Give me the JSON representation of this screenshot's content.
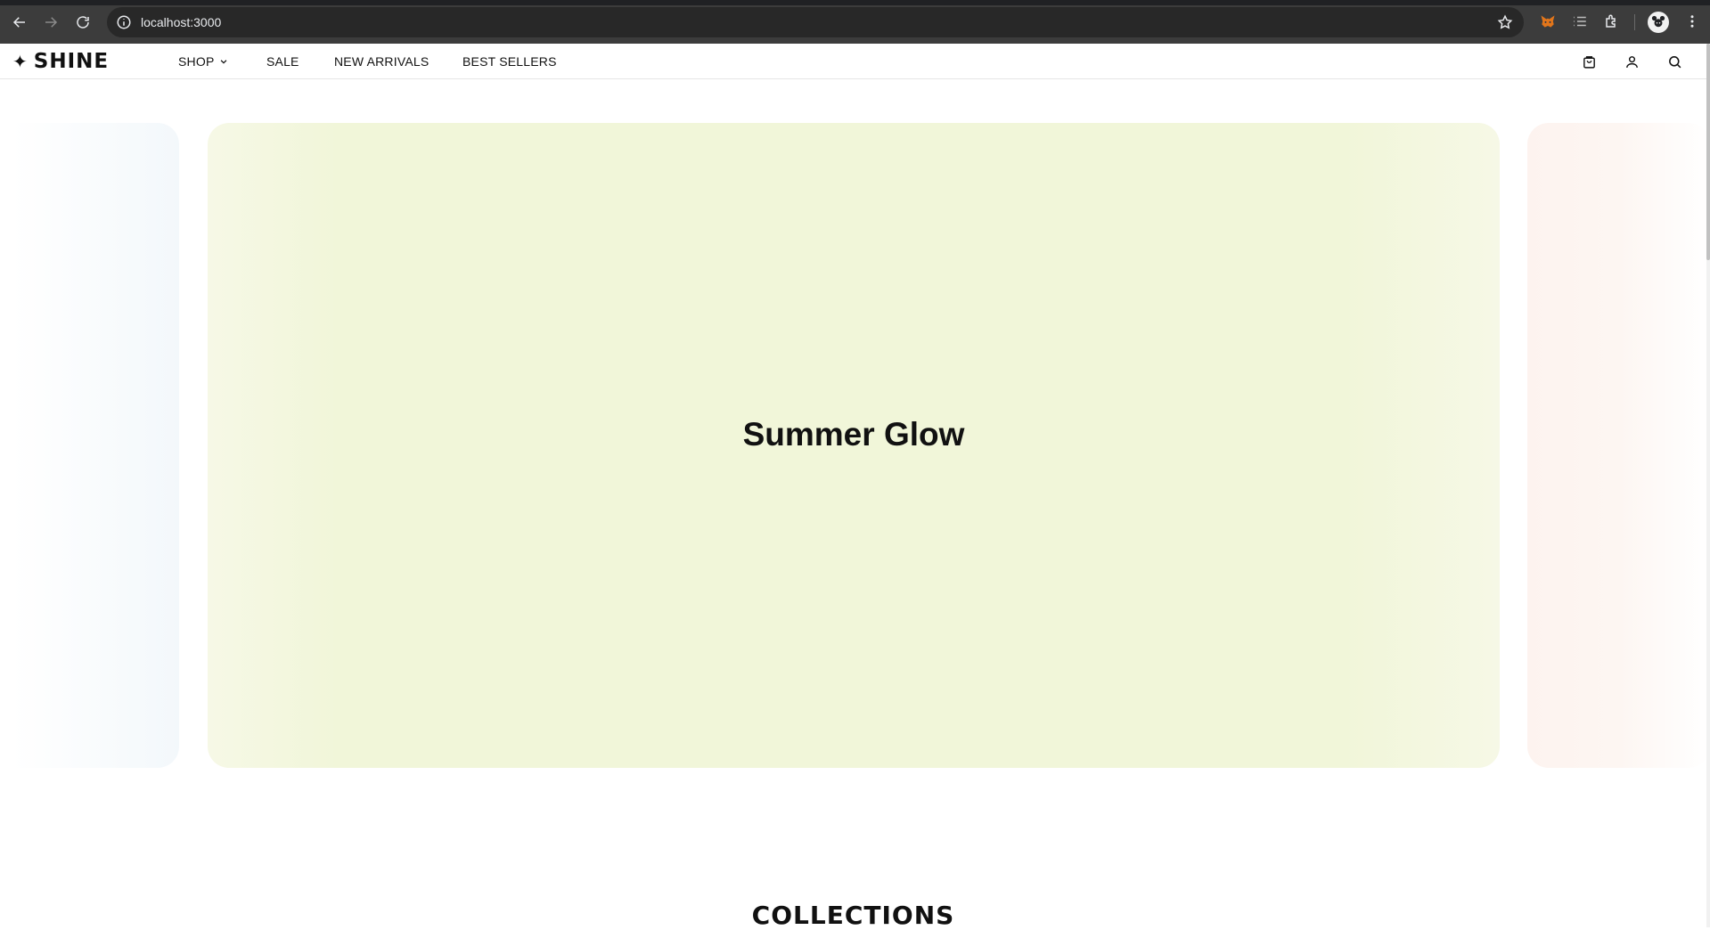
{
  "browser": {
    "url": "localhost:3000",
    "accent": "#3c3c3c"
  },
  "nav": {
    "logo_mark": "✦",
    "logo_text": "SHINE",
    "links": {
      "shop": "SHOP",
      "sale": "SALE",
      "new_arrivals": "NEW ARRIVALS",
      "best_sellers": "BEST SELLERS"
    },
    "icons": [
      "cart-icon",
      "user-icon",
      "search-icon"
    ]
  },
  "hero": {
    "slides": [
      {
        "title": "",
        "color": "#f3f8fb"
      },
      {
        "title": "Summer Glow",
        "color": "#f1f6d9"
      },
      {
        "title": "",
        "color": "#fdf3ef"
      }
    ]
  },
  "collections": {
    "heading": "COLLECTIONS"
  }
}
